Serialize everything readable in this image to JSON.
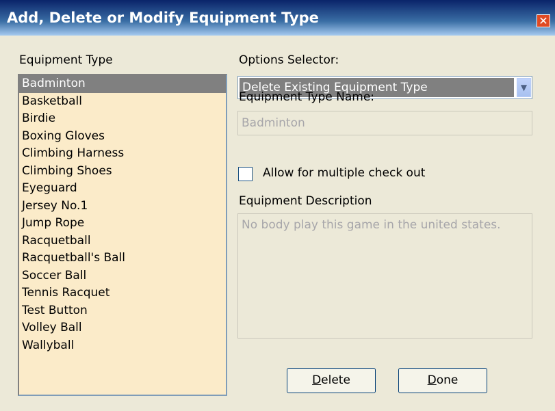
{
  "window": {
    "title": "Add, Delete or Modify Equipment Type",
    "close_glyph": "✕"
  },
  "equipment_list": {
    "label": "Equipment Type",
    "items": [
      {
        "label": "Badminton",
        "selected": true
      },
      {
        "label": "Basketball"
      },
      {
        "label": "Birdie"
      },
      {
        "label": "Boxing Gloves"
      },
      {
        "label": "Climbing Harness"
      },
      {
        "label": "Climbing Shoes"
      },
      {
        "label": "Eyeguard"
      },
      {
        "label": "Jersey No.1"
      },
      {
        "label": "Jump Rope"
      },
      {
        "label": "Racquetball"
      },
      {
        "label": "Racquetball's Ball"
      },
      {
        "label": "Soccer Ball"
      },
      {
        "label": "Tennis Racquet"
      },
      {
        "label": "Test Button"
      },
      {
        "label": "Volley Ball"
      },
      {
        "label": "Wallyball"
      }
    ]
  },
  "options_selector": {
    "label": "Options Selector:",
    "value": "Delete Existing Equipment Type"
  },
  "type_name": {
    "label": "Equipment Type Name:",
    "value": "Badminton"
  },
  "multiple_checkout": {
    "label": "Allow for multiple check out",
    "checked": false
  },
  "description": {
    "label": "Equipment Description",
    "value": "No body play this game in the united states."
  },
  "buttons": {
    "delete": {
      "mnemonic": "D",
      "rest": "elete"
    },
    "done": {
      "mnemonic": "D",
      "rest": "one"
    }
  },
  "colors": {
    "list_bg": "#fbebc9",
    "selection": "#808080",
    "title_bar": "#0a246a"
  }
}
